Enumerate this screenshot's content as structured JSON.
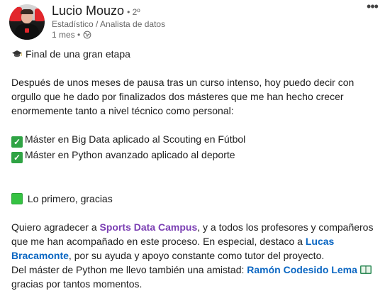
{
  "author": {
    "name": "Lucio Mouzo",
    "degree": "• 2º",
    "headline": "Estadístico / Analista de datos",
    "time": "1 mes •"
  },
  "menu": {
    "more_label": "•••"
  },
  "post": {
    "line1": "Final de una gran etapa",
    "para1": "Después de unos meses de pausa tras un curso intenso, hoy puedo decir con orgullo que he dado por finalizados dos másteres que me han hecho crecer enormemente tanto a nivel técnico como personal:",
    "bullets": [
      "Máster en Big Data aplicado al Scouting en Fútbol",
      "Máster en Python avanzado aplicado al deporte"
    ],
    "thanks": "Lo primero, gracias",
    "p3_a": "Quiero agradecer a ",
    "mention1": "Sports Data Campus",
    "p3_b": ", y a todos los profesores y compañeros que me han acompañado en este proceso. En especial, destaco a ",
    "mention2": "Lucas Bracamonte",
    "p3_c": ", por su ayuda y apoyo constante como tutor del proyecto.",
    "p4_a": "Del máster de Python me llevo también una amistad: ",
    "mention3": "Ramón Codesido Lema",
    "p4_b": "gracias por tantos momentos."
  },
  "icons": {
    "graduation": "graduation-cap-icon",
    "check": "check-mark-icon",
    "square": "green-square-icon",
    "book": "book-icon",
    "globe": "globe-icon"
  },
  "colors": {
    "mention_company": "#7b3fb3",
    "mention_person": "#0a66c2",
    "check": "#2fa344"
  }
}
